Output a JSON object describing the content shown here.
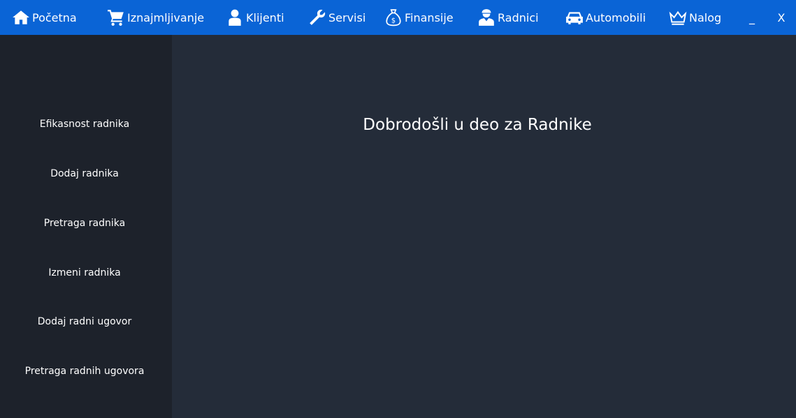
{
  "nav": {
    "items": [
      {
        "label": "Početna",
        "icon": "home-icon"
      },
      {
        "label": "Iznajmljivanje",
        "icon": "cart-icon"
      },
      {
        "label": "Klijenti",
        "icon": "user-icon"
      },
      {
        "label": "Servisi",
        "icon": "wrench-icon"
      },
      {
        "label": "Finansije",
        "icon": "money-bag-icon"
      },
      {
        "label": "Radnici",
        "icon": "worker-icon"
      },
      {
        "label": "Automobili",
        "icon": "car-icon"
      },
      {
        "label": "Nalog",
        "icon": "crown-icon"
      }
    ],
    "minimize_label": "_",
    "close_label": "X"
  },
  "sidebar": {
    "items": [
      {
        "label": "Efikasnost radnika"
      },
      {
        "label": "Dodaj radnika"
      },
      {
        "label": "Pretraga radnika"
      },
      {
        "label": "Izmeni radnika"
      },
      {
        "label": "Dodaj radni ugovor"
      },
      {
        "label": "Pretraga radnih ugovora"
      }
    ]
  },
  "main": {
    "welcome": "Dobrodošli u deo za Radnike"
  },
  "colors": {
    "topbar": "#0a64d6",
    "sidebar": "#1d222b",
    "main": "#242c39",
    "text": "#ffffff"
  }
}
